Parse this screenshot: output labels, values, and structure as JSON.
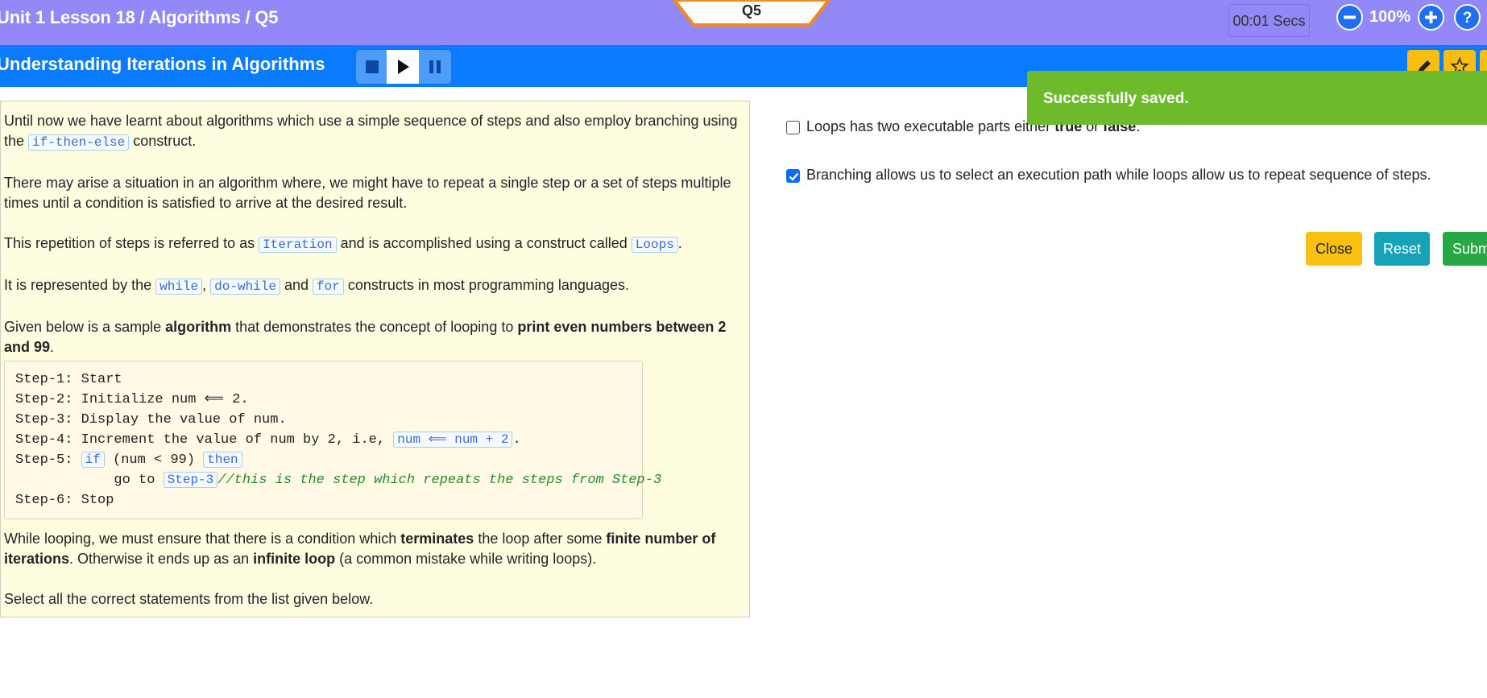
{
  "header": {
    "breadcrumb": "Unit 1 Lesson 18 / Algorithms / Q5",
    "question_tab": "Q5",
    "timer": "00:01 Secs",
    "zoom_level": "100%",
    "zoom_out_icon": "minus-circle-icon",
    "zoom_in_icon": "plus-circle-icon",
    "help_icon": "question-circle-icon"
  },
  "title_bar": {
    "title": "Understanding Iterations in Algorithms",
    "media_controls": [
      "stop-icon",
      "play-icon",
      "pause-icon"
    ],
    "tools": [
      "pencil-icon",
      "star-icon"
    ]
  },
  "content": {
    "p1_a": "Until now we have learnt about algorithms which use a simple sequence of steps and also employ branching using the ",
    "p1_code": "if-then-else",
    "p1_b": " construct.",
    "p2": "There may arise a situation in an algorithm where, we might have to repeat a single step or a set of steps multiple times until a condition is satisfied to arrive at the desired result.",
    "p3_a": "This repetition of steps is referred to as ",
    "p3_code1": "Iteration",
    "p3_b": " and is accomplished using a construct called ",
    "p3_code2": "Loops",
    "p3_c": ".",
    "p4_a": "It is represented by the ",
    "p4_code1": "while",
    "p4_sep": ", ",
    "p4_code2": "do-while",
    "p4_and": " and ",
    "p4_code3": "for",
    "p4_b": " constructs in most programming languages.",
    "p5_a": "Given below is a sample ",
    "p5_bold1": "algorithm",
    "p5_b": " that demonstrates the concept of looping to ",
    "p5_bold2": "print even numbers between 2 and 99",
    "p5_c": ".",
    "code": {
      "step1": "Step-1: Start",
      "step2": "Step-2: Initialize num ⟸ 2.",
      "step3": "Step-3: Display the value of num.",
      "step4_a": "Step-4: Increment the value of num by 2, i.e, ",
      "step4_code": "num ⟸ num + 2",
      "step4_b": ".",
      "step5_a": "Step-5: ",
      "step5_if": "if",
      "step5_b": " (num < 99) ",
      "step5_then": "then",
      "goto_a": "            go to ",
      "goto_code": "Step-3",
      "goto_comment": "//this is the step which repeats the steps from Step-3",
      "step6": "Step-6: Stop"
    },
    "p6_a": "While looping, we must ensure that there is a condition which ",
    "p6_bold1": "terminates",
    "p6_b": " the loop after some ",
    "p6_bold2": "finite number of iterations",
    "p6_c": ". Otherwise it ends up as an ",
    "p6_bold3": "infinite loop",
    "p6_d": " (a common mistake while writing loops).",
    "p7": "Select all the correct statements from the list given below."
  },
  "options": [
    {
      "text_a": "Loops has two executable parts either ",
      "bold1": "true",
      "text_b": " or ",
      "bold2": "false",
      "text_c": ".",
      "checked": false
    },
    {
      "text": "Branching allows us to select an execution path while loops allow us to repeat sequence of steps.",
      "checked": true
    }
  ],
  "buttons": {
    "close": "Close",
    "reset": "Reset",
    "submit": "Submit"
  },
  "toast": {
    "message": "Successfully saved."
  },
  "colors": {
    "header_bg": "#9288f8",
    "title_bar_bg": "#0a7bff",
    "content_bg": "#fffde0",
    "toast_bg": "#6dba2b",
    "close_btn": "#f8c010",
    "reset_btn": "#17a2b8",
    "submit_btn": "#28a745"
  }
}
